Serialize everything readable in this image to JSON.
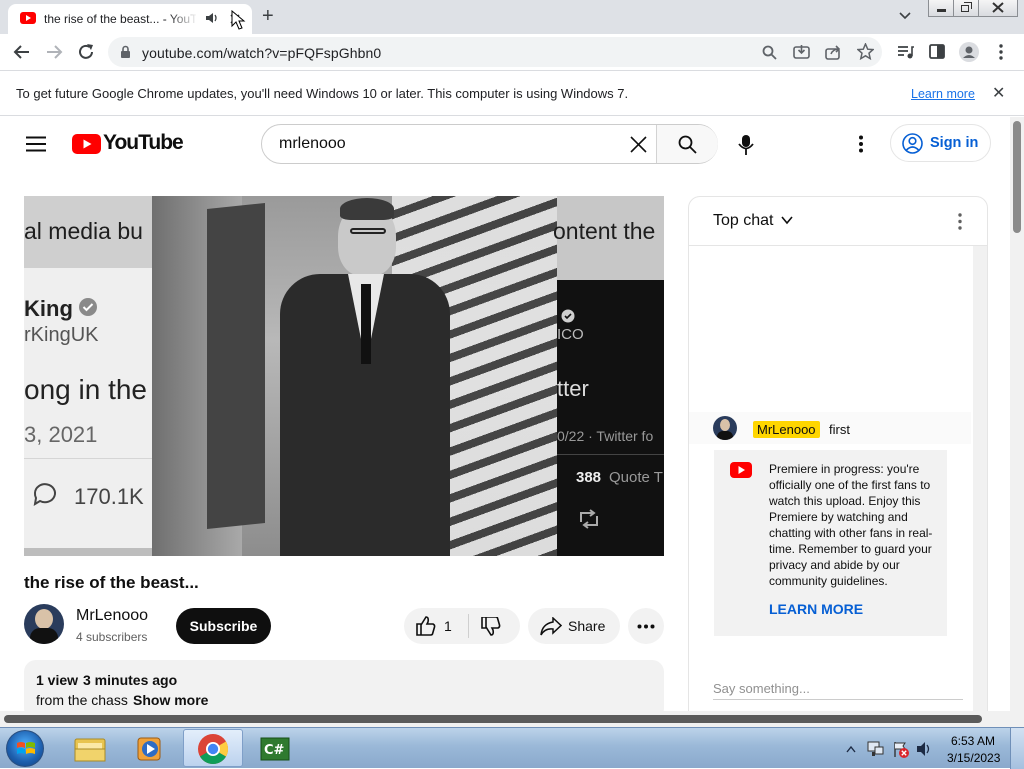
{
  "browser": {
    "tab_title": "the rise of the beast... - YouTube",
    "new_tab_symbol": "+",
    "url": "youtube.com/watch?v=pFQFspGhbn0",
    "infobar_text": "To get future Google Chrome updates, you'll need Windows 10 or later. This computer is using Windows 7.",
    "infobar_link": "Learn more",
    "infobar_close": "✕"
  },
  "youtube": {
    "logo_text": "YouTube",
    "search_value": "mrlenooo",
    "sign_in": "Sign in"
  },
  "video": {
    "title": "the rise of the beast...",
    "channel": "MrLenooo",
    "subscribers": "4 subscribers",
    "subscribe_label": "Subscribe",
    "likes": "1",
    "share_label": "Share",
    "views": "1 view",
    "uploaded": "3 minutes ago",
    "description": "from the chass",
    "show_more": "Show more",
    "thumbnail_text": {
      "left_top": "al media bu",
      "left_name": "King",
      "left_handle": "rKingUK",
      "left_line": "ong in the",
      "left_date": "3, 2021",
      "left_count": "170.1K",
      "right_top": "ontent the",
      "right_ico": "ICO",
      "right_line": "tter",
      "right_date": "0/22 · Twitter fo",
      "right_count": "388",
      "right_count_label": "Quote T"
    }
  },
  "chat": {
    "header": "Top chat",
    "message_author": "MrLenooo",
    "message_text": "first",
    "premiere_text": "Premiere in progress: you're officially one of the first fans to watch this upload. Enjoy this Premiere by watching and chatting with other fans in real-time. Remember to guard your privacy and abide by our community guidelines.",
    "premiere_learn_more": "LEARN MORE",
    "input_placeholder": "Say something..."
  },
  "taskbar": {
    "time": "6:53 AM",
    "date": "3/15/2023",
    "apps": [
      "start-orb",
      "explorer",
      "media-player",
      "chrome",
      "csharp-editor"
    ]
  },
  "colors": {
    "youtube_red": "#ff0000",
    "chrome_tabstrip": "#dee1e6",
    "link_blue": "#065fd4",
    "chat_highlight": "#ffd600"
  }
}
